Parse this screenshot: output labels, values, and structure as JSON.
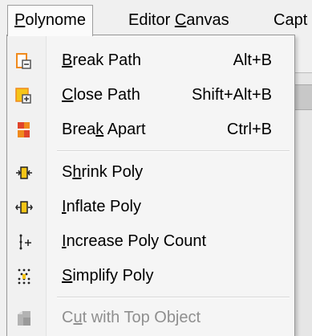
{
  "menubar": {
    "items": [
      {
        "pre": "",
        "ul": "P",
        "post": "olynome"
      },
      {
        "pre": "Editor ",
        "ul": "C",
        "post": "anvas"
      },
      {
        "pre": "Capt",
        "ul": "",
        "post": ""
      }
    ]
  },
  "menu": {
    "items": [
      {
        "pre": "",
        "ul": "B",
        "post": "reak Path",
        "shortcut": "Alt+B",
        "icon": "break-path-icon",
        "enabled": true
      },
      {
        "pre": "",
        "ul": "C",
        "post": "lose Path",
        "shortcut": "Shift+Alt+B",
        "icon": "close-path-icon",
        "enabled": true
      },
      {
        "pre": "Brea",
        "ul": "k",
        "post": " Apart",
        "shortcut": "Ctrl+B",
        "icon": "break-apart-icon",
        "enabled": true
      },
      {
        "pre": "S",
        "ul": "h",
        "post": "rink Poly",
        "shortcut": "",
        "icon": "shrink-poly-icon",
        "enabled": true
      },
      {
        "pre": "",
        "ul": "I",
        "post": "nflate Poly",
        "shortcut": "",
        "icon": "inflate-poly-icon",
        "enabled": true
      },
      {
        "pre": "",
        "ul": "I",
        "post": "ncrease Poly Count",
        "shortcut": "",
        "icon": "increase-poly-count-icon",
        "enabled": true
      },
      {
        "pre": "",
        "ul": "S",
        "post": "implify Poly",
        "shortcut": "",
        "icon": "simplify-poly-icon",
        "enabled": true
      },
      {
        "pre": "C",
        "ul": "u",
        "post": "t with Top Object",
        "shortcut": "",
        "icon": "cut-with-top-object-icon",
        "enabled": false
      }
    ]
  },
  "colors": {
    "accent_orange": "#f08a1c",
    "accent_yellow": "#f5c518",
    "accent_red": "#e0442a",
    "disabled_text": "#8f8f8f"
  }
}
